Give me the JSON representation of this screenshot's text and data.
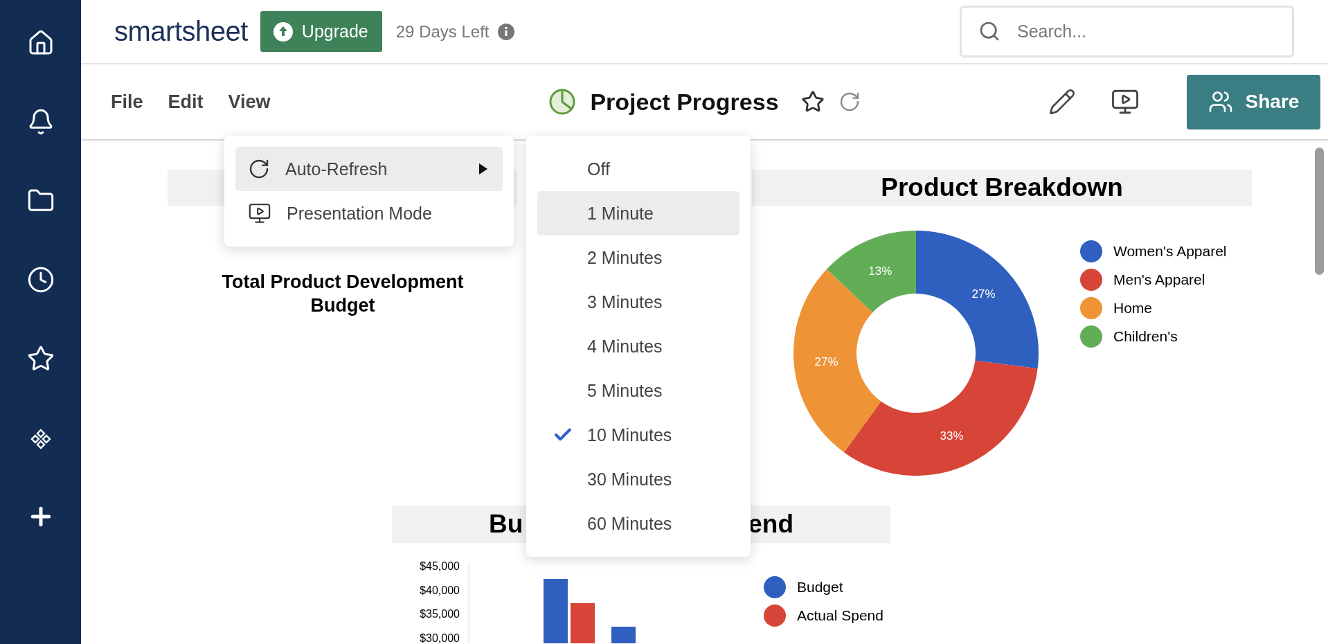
{
  "header": {
    "logo": "smartsheet",
    "upgrade_button": "Upgrade",
    "trial_notice": "29 Days Left",
    "search": {
      "placeholder": "Search..."
    }
  },
  "toolbar": {
    "menus": [
      "File",
      "Edit",
      "View"
    ],
    "title": "Project Progress",
    "share_button": "Share"
  },
  "view_menu": {
    "items": [
      {
        "kind": "refresh",
        "label": "Auto-Refresh",
        "highlighted": true,
        "has_submenu": true
      },
      {
        "kind": "presentation",
        "label": "Presentation Mode",
        "highlighted": false,
        "has_submenu": false
      }
    ]
  },
  "refresh_submenu": {
    "items": [
      {
        "label": "Off",
        "selected": false,
        "highlighted": false
      },
      {
        "label": "1 Minute",
        "selected": false,
        "highlighted": true
      },
      {
        "label": "2 Minutes",
        "selected": false,
        "highlighted": false
      },
      {
        "label": "3 Minutes",
        "selected": false,
        "highlighted": false
      },
      {
        "label": "4 Minutes",
        "selected": false,
        "highlighted": false
      },
      {
        "label": "5 Minutes",
        "selected": false,
        "highlighted": false
      },
      {
        "label": "10 Minutes",
        "selected": true,
        "highlighted": false
      },
      {
        "label": "30 Minutes",
        "selected": false,
        "highlighted": false
      },
      {
        "label": "60 Minutes",
        "selected": false,
        "highlighted": false
      }
    ]
  },
  "metric_widget": {
    "caption": "Total Product Development Budget"
  },
  "breakdown_widget": {
    "title": "Product Breakdown",
    "chart_data": {
      "type": "donut",
      "categories": [
        "Women's Apparel",
        "Men's Apparel",
        "Home",
        "Children's"
      ],
      "values": [
        27,
        33,
        27,
        13
      ],
      "colors": [
        "#3060bf",
        "#d64537",
        "#ee9336",
        "#62ae56"
      ],
      "value_labels": [
        "27%",
        "33%",
        "27%",
        "13%"
      ]
    }
  },
  "spend_widget": {
    "title_parts": [
      "Bu",
      "end"
    ],
    "y_axis_labels": [
      "$45,000",
      "$40,000",
      "$35,000",
      "$30,000"
    ],
    "legend": [
      {
        "label": "Budget",
        "color": "#3060bf"
      },
      {
        "label": "Actual Spend",
        "color": "#d64537"
      }
    ]
  }
}
